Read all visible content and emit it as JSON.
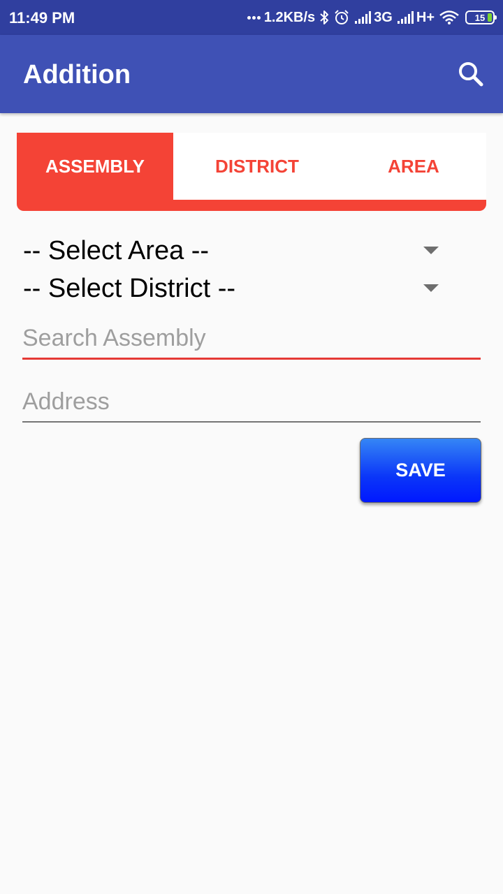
{
  "status_bar": {
    "time": "11:49 PM",
    "net_speed": "1.2KB/s",
    "network_1": "3G",
    "network_2": "H+",
    "battery": "15",
    "icons": [
      "bluetooth-icon",
      "alarm-icon",
      "signal-icon",
      "wifi-icon",
      "battery-icon"
    ]
  },
  "app_bar": {
    "title": "Addition",
    "search_icon": "search-icon"
  },
  "tabs": [
    {
      "label": "ASSEMBLY",
      "active": true
    },
    {
      "label": "DISTRICT",
      "active": false
    },
    {
      "label": "AREA",
      "active": false
    }
  ],
  "form": {
    "area_spinner": "-- Select Area --",
    "district_spinner": "-- Select District --",
    "search_placeholder": "Search Assembly",
    "address_placeholder": "Address",
    "save_label": "SAVE"
  },
  "colors": {
    "status_bar": "#303f9f",
    "app_bar": "#3f51b5",
    "accent": "#f44336",
    "save_button": "#0b36f8",
    "background": "#fafafa"
  }
}
